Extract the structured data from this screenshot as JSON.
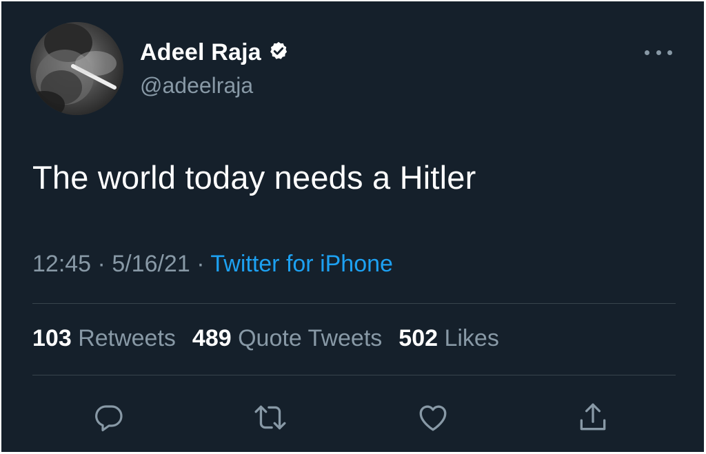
{
  "user": {
    "display_name": "Adeel Raja",
    "handle": "@adeelraja",
    "verified": true,
    "avatar": "profile-photo"
  },
  "tweet": {
    "text": "The world today needs a Hitler",
    "time": "12:45",
    "separator": " · ",
    "date": "5/16/21",
    "source": "Twitter for iPhone"
  },
  "stats": {
    "retweets_count": "103",
    "retweets_label": "Retweets",
    "quotes_count": "489",
    "quotes_label": "Quote Tweets",
    "likes_count": "502",
    "likes_label": "Likes"
  },
  "icons": {
    "more": "more-horizontal-icon",
    "reply": "reply-icon",
    "retweet": "retweet-icon",
    "like": "heart-icon",
    "share": "share-icon",
    "verified": "verified-badge-icon"
  },
  "colors": {
    "background": "#15202b",
    "primary_text": "#ffffff",
    "secondary_text": "#8899a6",
    "link": "#1da1f2",
    "divider": "#38444d"
  }
}
